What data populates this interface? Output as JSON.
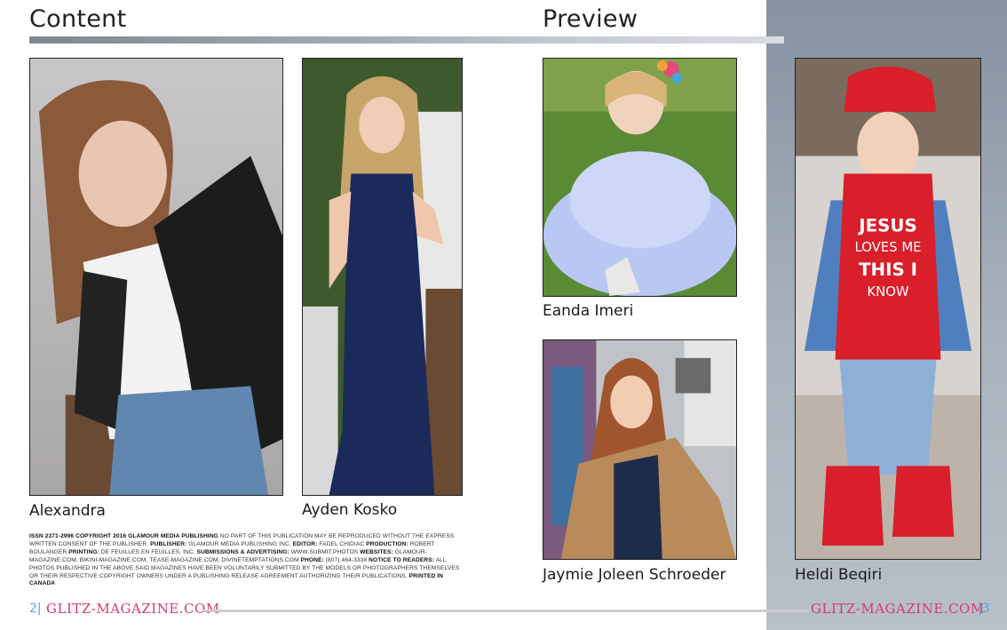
{
  "headings": {
    "content": "Content",
    "preview": "Preview"
  },
  "photos": [
    {
      "id": "alexandra",
      "caption": "Alexandra"
    },
    {
      "id": "ayden",
      "caption": "Ayden Kosko"
    },
    {
      "id": "eanda",
      "caption": "Eanda Imeri"
    },
    {
      "id": "jaymie",
      "caption": "Jaymie Joleen Schroeder"
    },
    {
      "id": "heldi",
      "caption": "Heldi Beqiri"
    }
  ],
  "shirt_text": {
    "line1": "JESUS",
    "line2": "LOVES ME",
    "line3": "THIS I",
    "line4": "KNOW"
  },
  "legal": {
    "issn_label": "ISSN 2371-2996 COPYRIGHT 2016 GLAMOUR MEDIA PUBLISHING",
    "issn_text": " NO PART OF THIS PUBLICATION MAY BE REPRODUCED WITHOUT THE EXPRESS WRITTEN CONSENT OF THE PUBLISHER. ",
    "publisher_label": "PUBLISHER:",
    "publisher_text": " GLAMOUR MEDIA PUBLISHING INC. ",
    "editor_label": "EDITOR:",
    "editor_text": " FADEL CHIDIAC ",
    "production_label": "PRODUCTION:",
    "production_text": " ROBERT BOULANGER ",
    "printing_label": "PRINTING:",
    "printing_text": " DE FEUILLES EN FEUILLES, INC. ",
    "submissions_label": "SUBMISSIONS & ADVERTISING:",
    "submissions_text": " WWW.SUBMIT.PHOTOS ",
    "websites_label": "WEBSITES:",
    "websites_text": " GLAMOUR-MAGAZINE.COM, BIKINI-MAGAZINE.COM, TEASE-MAGAZINE.COM, DIVINETEMPTATIONS.COM ",
    "phone_label": "PHONE:",
    "phone_text": " (807) 464-3338 ",
    "notice_label": "NOTICE TO READERS:",
    "notice_text": " ALL PHOTOS PUBLISHED IN THE ABOVE SAID MAGAZINES HAVE BEEN VOLUNTARILY SUBMITTED BY THE MODELS OR PHOTOGRAPHERS THEMSELVES OR THEIR RESPECTIVE COPYRIGHT OWNERS UNDER A PUBLISHING RELEASE AGREEMENT AUTHORIZING THEIR PUBLICATIONS. ",
    "printed_label": "PRINTED IN CANADA"
  },
  "footer": {
    "page_left": "2",
    "page_right": "3",
    "brand": "GLITZ-MAGAZINE.COM"
  },
  "colors": {
    "brand": "#d63a6e",
    "page_number": "#5aa9d6",
    "panel": "#8592a0"
  }
}
